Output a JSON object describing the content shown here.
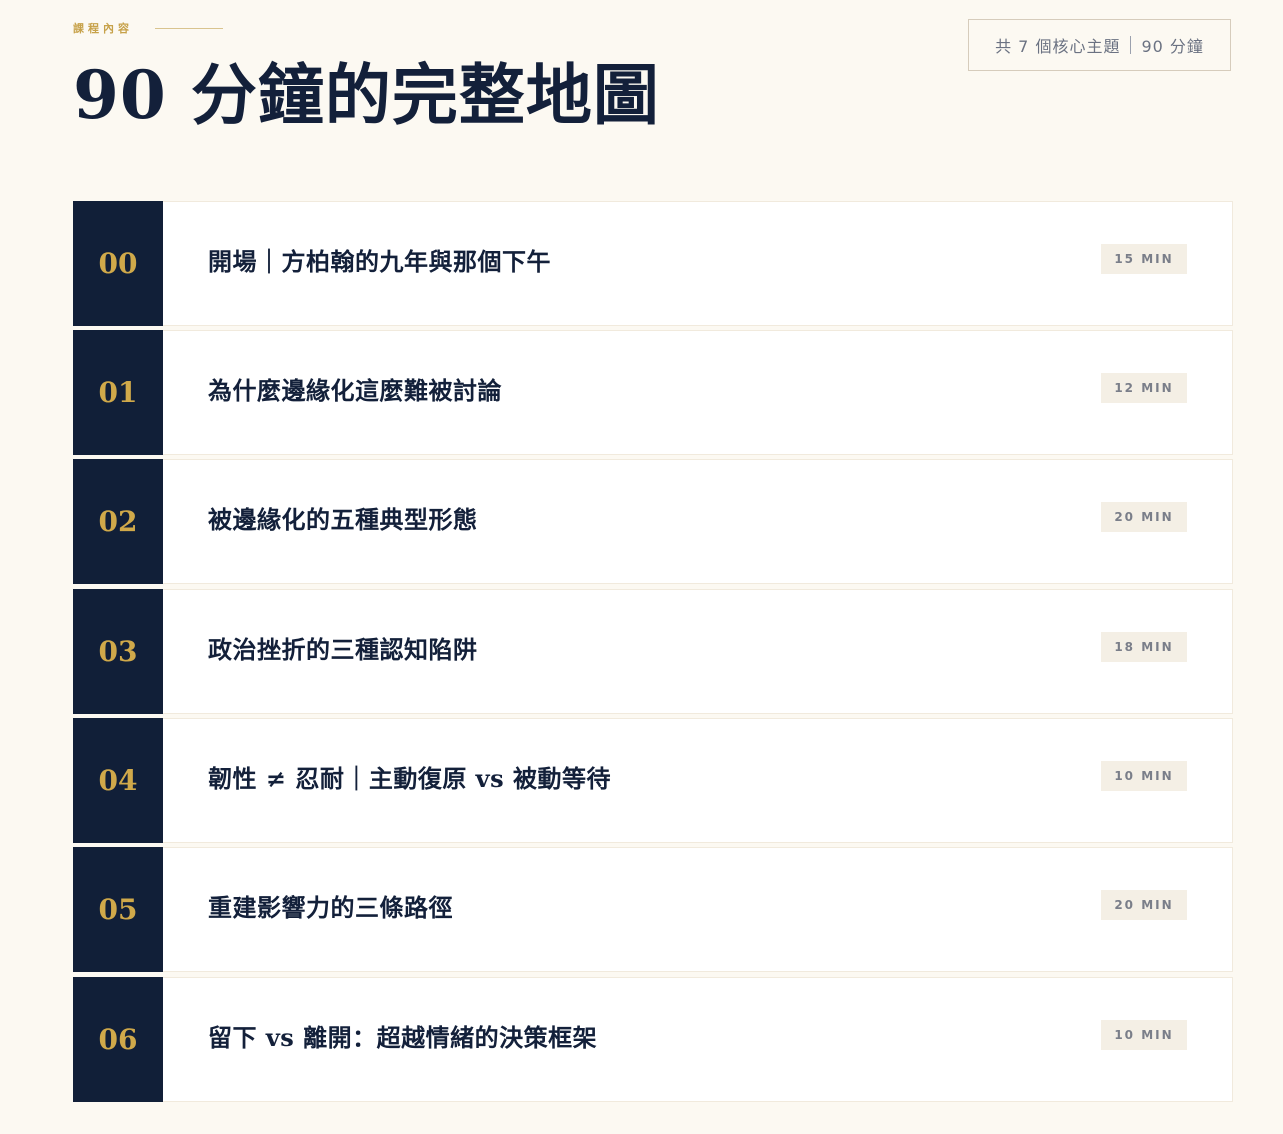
{
  "header": {
    "eyebrow": "課程內容",
    "title": "90 分鐘的完整地圖",
    "summary_topics": "共 7 個核心主題",
    "summary_duration": "90 分鐘"
  },
  "topics": [
    {
      "number": "00",
      "title": "開場｜方柏翰的九年與那個下午",
      "duration": "15 MIN"
    },
    {
      "number": "01",
      "title": "為什麼邊緣化這麼難被討論",
      "duration": "12 MIN"
    },
    {
      "number": "02",
      "title": "被邊緣化的五種典型形態",
      "duration": "20 MIN"
    },
    {
      "number": "03",
      "title": "政治挫折的三種認知陷阱",
      "duration": "18 MIN"
    },
    {
      "number": "04",
      "title": "韌性 ≠ 忍耐｜主動復原 vs 被動等待",
      "duration": "10 MIN"
    },
    {
      "number": "05",
      "title": "重建影響力的三條路徑",
      "duration": "20 MIN"
    },
    {
      "number": "06",
      "title": "留下 vs 離開：超越情緒的決策框架",
      "duration": "10 MIN"
    }
  ],
  "colors": {
    "background": "#fcf9f2",
    "navy": "#111f38",
    "gold": "#d0a94a",
    "badge": "#f4efe5"
  }
}
